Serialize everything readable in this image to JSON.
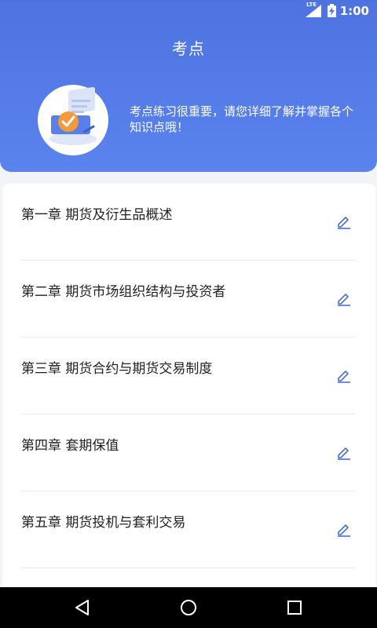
{
  "status_bar": {
    "time": "1:00",
    "network": "LTE",
    "signal_icon": "signal-icon",
    "battery_icon": "battery-charging-icon"
  },
  "header": {
    "title": "考点",
    "intro": "考点练习很重要，请您详细了解并掌握各个知识点哦！",
    "illustration_icon": "checklist-illustration"
  },
  "chapters": [
    {
      "label": "第一章  期货及衍生品概述"
    },
    {
      "label": "第二章  期货市场组织结构与投资者"
    },
    {
      "label": "第三章  期货合约与期货交易制度"
    },
    {
      "label": "第四章  套期保值"
    },
    {
      "label": "第五章  期货投机与套利交易"
    }
  ],
  "edit_icon": "pencil-icon",
  "nav_bar": {
    "back": "back-icon",
    "home": "home-icon",
    "recents": "recents-icon"
  },
  "colors": {
    "primary": "#4e73e0",
    "accent_icon": "#4a6fd8",
    "orange": "#f39a3a"
  }
}
